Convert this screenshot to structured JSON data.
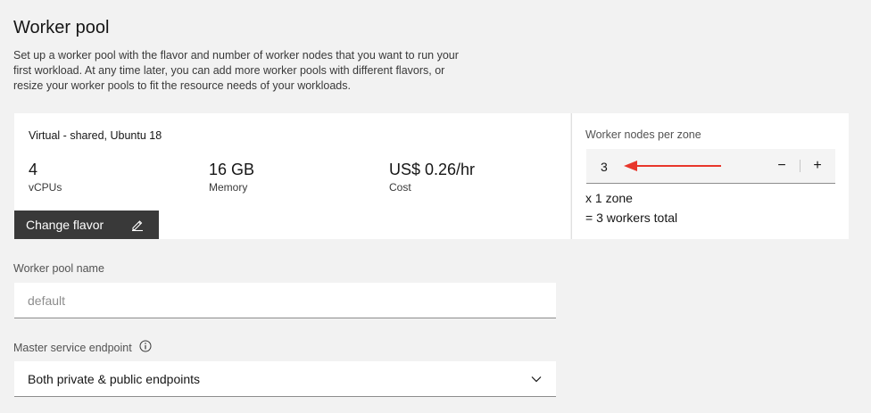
{
  "section": {
    "title": "Worker pool",
    "description": "Set up a worker pool with the flavor and number of worker nodes that you want to run your first workload. At any time later, you can add more worker pools with different flavors, or resize your worker pools to fit the resource needs of your workloads."
  },
  "flavor": {
    "name": "Virtual - shared, Ubuntu 18",
    "metrics": [
      {
        "value": "4",
        "label": "vCPUs"
      },
      {
        "value": "16 GB",
        "label": "Memory"
      },
      {
        "value": "US$ 0.26/hr",
        "label": "Cost"
      }
    ],
    "change_button": "Change flavor",
    "change_icon": "edit-icon"
  },
  "worker_nodes": {
    "label": "Worker nodes per zone",
    "value": "3",
    "decrement": "−",
    "increment": "+",
    "zones_line": "x 1 zone",
    "total_line": "= 3 workers total",
    "annotation_color": "#e8362b"
  },
  "pool_name": {
    "label": "Worker pool name",
    "placeholder": "default",
    "value": ""
  },
  "endpoint": {
    "label": "Master service endpoint",
    "info_icon": "info-icon",
    "selected": "Both private & public endpoints",
    "chevron_icon": "chevron-down-icon"
  }
}
